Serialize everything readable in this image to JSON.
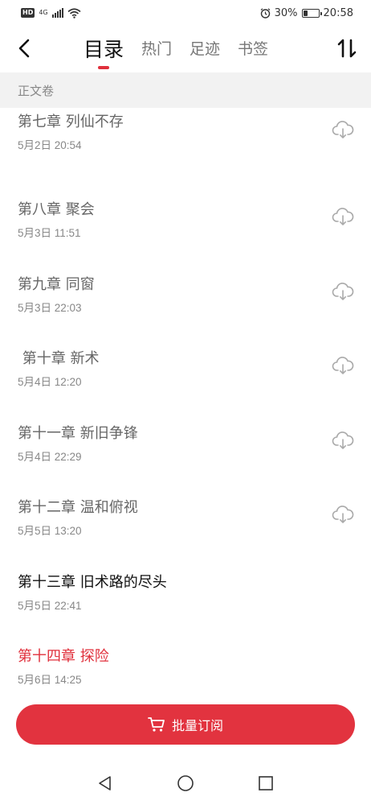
{
  "status_bar": {
    "left_badge": "HD",
    "network": "4G",
    "battery_percent": "30%",
    "battery_level": 0.3,
    "time": "20:58",
    "alarm_icon": "alarm-clock-icon",
    "wifi_icon": "wifi-icon",
    "signal_icon": "cell-signal-icon"
  },
  "header": {
    "tabs": [
      {
        "label": "目录",
        "active": true
      },
      {
        "label": "热门",
        "active": false
      },
      {
        "label": "足迹",
        "active": false
      },
      {
        "label": "书签",
        "active": false
      }
    ],
    "back_icon": "chevron-left-icon",
    "sort_icon": "sort-arrows-icon",
    "accent_color": "#e0303c"
  },
  "section": {
    "label": "正文卷"
  },
  "chapters": [
    {
      "title": "第七章 列仙不存",
      "date": "5月2日 20:54",
      "state": "locked",
      "icon": "cloud-download-icon"
    },
    {
      "title": "第八章 聚会",
      "date": "5月3日 11:51",
      "state": "locked",
      "icon": "cloud-download-icon"
    },
    {
      "title": "第九章 同窗",
      "date": "5月3日 22:03",
      "state": "locked",
      "icon": "cloud-download-icon"
    },
    {
      "title": " 第十章 新术",
      "date": "5月4日 12:20",
      "state": "locked",
      "icon": "cloud-download-icon"
    },
    {
      "title": "第十一章 新旧争锋",
      "date": "5月4日 22:29",
      "state": "locked",
      "icon": "cloud-download-icon"
    },
    {
      "title": "第十二章 温和俯视",
      "date": "5月5日 13:20",
      "state": "locked",
      "icon": "cloud-download-icon"
    },
    {
      "title": "第十三章 旧术路的尽头",
      "date": "5月5日 22:41",
      "state": "read",
      "icon": ""
    },
    {
      "title": "第十四章 探险",
      "date": "5月6日 14:25",
      "state": "current",
      "icon": ""
    }
  ],
  "bottom": {
    "batch_label": "批量订阅",
    "batch_icon": "cart-icon",
    "button_color": "#e2333f"
  },
  "navbar": {
    "back_icon": "triangle-back-icon",
    "home_icon": "circle-home-icon",
    "recents_icon": "square-recents-icon"
  }
}
